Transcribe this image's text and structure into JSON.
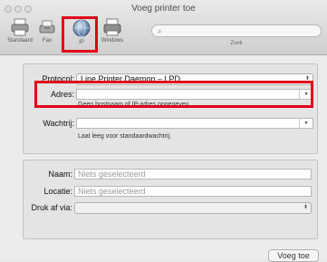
{
  "window": {
    "title": "Voeg printer toe"
  },
  "toolbar": {
    "items": [
      {
        "label": "Standaard",
        "icon": "default-printer-icon"
      },
      {
        "label": "Fax",
        "icon": "fax-icon"
      },
      {
        "label": "IP",
        "icon": "ip-globe-icon"
      },
      {
        "label": "Windows",
        "icon": "windows-printer-icon"
      }
    ],
    "search_label": "Zoek",
    "search_glyph": "⌕"
  },
  "form": {
    "protocol_label": "Protocol:",
    "protocol_value": "Line Printer Daemon – LPD",
    "address_label": "Adres:",
    "address_value": "",
    "address_hint": "Geen hostnaam of IP-adres opgegeven",
    "queue_label": "Wachtrij:",
    "queue_value": "",
    "queue_hint": "Laat leeg voor standaardwachtrij.",
    "name_label": "Naam:",
    "name_placeholder": "Niets geselecteerd",
    "location_label": "Locatie:",
    "location_placeholder": "Niets geselecteerd",
    "driver_label": "Druk af via:",
    "driver_value": ""
  },
  "actions": {
    "add_label": "Voeg toe"
  },
  "highlight_color": "#e0001a"
}
